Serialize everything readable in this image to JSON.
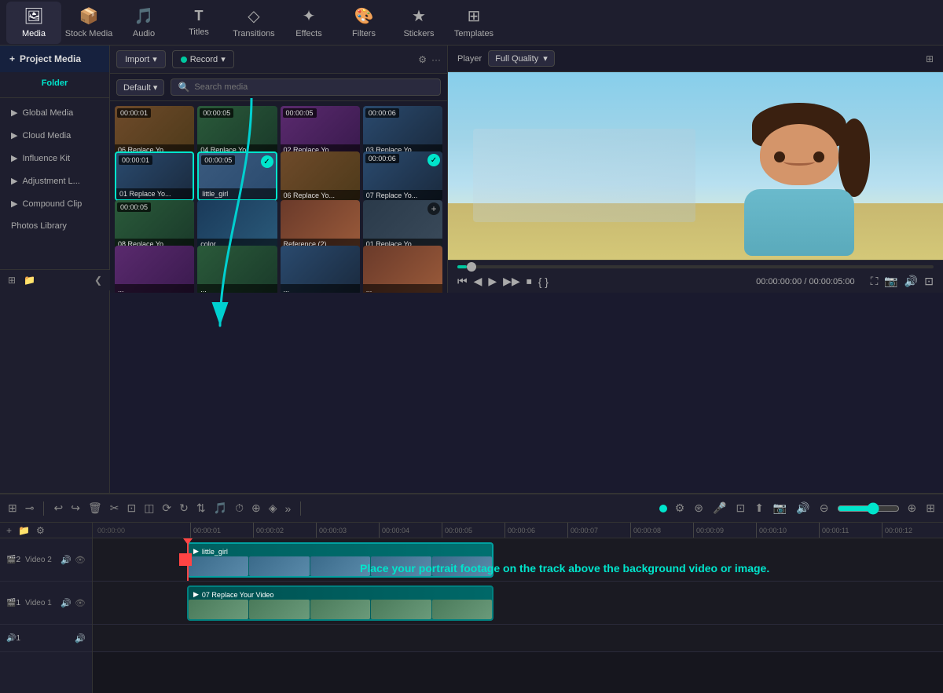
{
  "app": {
    "title": "Video Editor"
  },
  "toolbar": {
    "items": [
      {
        "id": "media",
        "label": "Media",
        "icon": "🖼",
        "active": true
      },
      {
        "id": "stock",
        "label": "Stock Media",
        "icon": "📦"
      },
      {
        "id": "audio",
        "label": "Audio",
        "icon": "🎵"
      },
      {
        "id": "titles",
        "label": "Titles",
        "icon": "T"
      },
      {
        "id": "transitions",
        "label": "Transitions",
        "icon": "◇"
      },
      {
        "id": "effects",
        "label": "Effects",
        "icon": "✦"
      },
      {
        "id": "filters",
        "label": "Filters",
        "icon": "🎨"
      },
      {
        "id": "stickers",
        "label": "Stickers",
        "icon": "★"
      },
      {
        "id": "templates",
        "label": "Templates",
        "icon": "⊞"
      }
    ]
  },
  "sidebar": {
    "header": "Project Media",
    "active_item": "Folder",
    "items": [
      {
        "label": "Global Media"
      },
      {
        "label": "Cloud Media"
      },
      {
        "label": "Influence Kit"
      },
      {
        "label": "Adjustment L..."
      },
      {
        "label": "Compound Clip"
      },
      {
        "label": "Photos Library"
      }
    ]
  },
  "media_panel": {
    "import_label": "Import",
    "record_label": "Record",
    "default_label": "Default",
    "search_placeholder": "Search media",
    "thumbnails": [
      {
        "label": "06 Replace Yo...",
        "duration": "00:00:01",
        "type": "video",
        "checked": false
      },
      {
        "label": "04 Replace Yo...",
        "duration": "00:00:05",
        "type": "video",
        "checked": false
      },
      {
        "label": "02 Replace Yo...",
        "duration": "00:00:05",
        "type": "video",
        "checked": false
      },
      {
        "label": "03 Replace Yo...",
        "duration": "00:00:06",
        "type": "video",
        "checked": false
      },
      {
        "label": "01 Replace Yo...",
        "duration": "00:00:01",
        "type": "video",
        "checked": false,
        "selected": true
      },
      {
        "label": "little_girl",
        "duration": "00:00:05",
        "type": "video",
        "checked": true,
        "selected": true
      },
      {
        "label": "06 Replace Yo...",
        "duration": "",
        "type": "video",
        "checked": false
      },
      {
        "label": "07 Replace Yo...",
        "duration": "00:00:06",
        "type": "video",
        "checked": true
      },
      {
        "label": "08 Replace Yo...",
        "duration": "00:00:05",
        "type": "video",
        "checked": false
      },
      {
        "label": "color",
        "duration": "",
        "type": "color"
      },
      {
        "label": "Reference (2)",
        "duration": "",
        "type": "image"
      },
      {
        "label": "01 Replace Yo...",
        "duration": "",
        "type": "video",
        "has_add": true
      }
    ]
  },
  "preview": {
    "player_label": "Player",
    "quality_label": "Full Quality",
    "time_current": "00:00:00:00",
    "time_total": "00:00:05:00"
  },
  "timeline": {
    "tracks": [
      {
        "id": "video2",
        "num": "2",
        "label": "Video 2",
        "clip_label": "little_girl"
      },
      {
        "id": "video1",
        "num": "1",
        "label": "Video 1",
        "clip_label": "07 Replace Your Video"
      },
      {
        "id": "audio1",
        "num": "1",
        "label": ""
      }
    ],
    "ruler_marks": [
      "00:00:01:00",
      "00:00:02:00",
      "00:00:03:00",
      "00:00:04:00",
      "00:00:05:00",
      "00:00:06:00",
      "00:00:07:00",
      "00:00:08:00",
      "00:00:09:00",
      "00:00:10:00",
      "00:00:11:00",
      "00:00:12:00"
    ]
  },
  "instruction": {
    "text": "Place your portrait footage on the track above the background video or image."
  }
}
